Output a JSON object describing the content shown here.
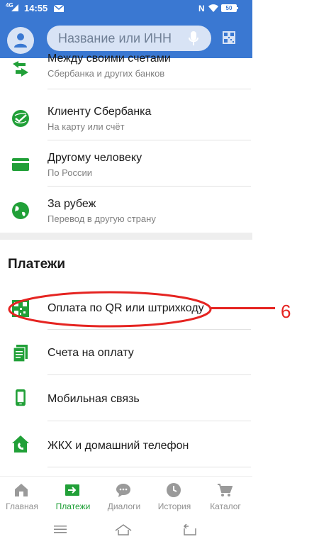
{
  "status_bar": {
    "network": "4G",
    "time": "14:55",
    "nfc": "N",
    "battery": "50"
  },
  "header": {
    "search_placeholder": "Название или ИНН"
  },
  "transfers": [
    {
      "title": "Между своими счетами",
      "subtitle": "Сбербанка и других банков",
      "icon": "transfer-arrows-icon"
    },
    {
      "title": "Клиенту Сбербанка",
      "subtitle": "На карту или счёт",
      "icon": "sberbank-logo-icon"
    },
    {
      "title": "Другому человеку",
      "subtitle": "По России",
      "icon": "card-icon"
    },
    {
      "title": "За рубеж",
      "subtitle": "Перевод в другую страну",
      "icon": "globe-icon"
    }
  ],
  "payments": {
    "title": "Платежи",
    "items": [
      {
        "title": "Оплата по QR или штрихкоду",
        "icon": "qr-code-icon"
      },
      {
        "title": "Счета на оплату",
        "icon": "invoice-icon"
      },
      {
        "title": "Мобильная связь",
        "icon": "mobile-phone-icon"
      },
      {
        "title": "ЖКХ и домашний телефон",
        "icon": "house-phone-icon"
      }
    ]
  },
  "bottom_nav": [
    {
      "label": "Главная",
      "icon": "home-icon",
      "active": false
    },
    {
      "label": "Платежи",
      "icon": "payments-icon",
      "active": true
    },
    {
      "label": "Диалоги",
      "icon": "chat-icon",
      "active": false
    },
    {
      "label": "История",
      "icon": "clock-icon",
      "active": false
    },
    {
      "label": "Каталог",
      "icon": "cart-icon",
      "active": false
    }
  ],
  "annotation": {
    "label": "6"
  },
  "colors": {
    "header": "#3a78d2",
    "accent_green": "#21a038",
    "annotation_red": "#e52421"
  }
}
